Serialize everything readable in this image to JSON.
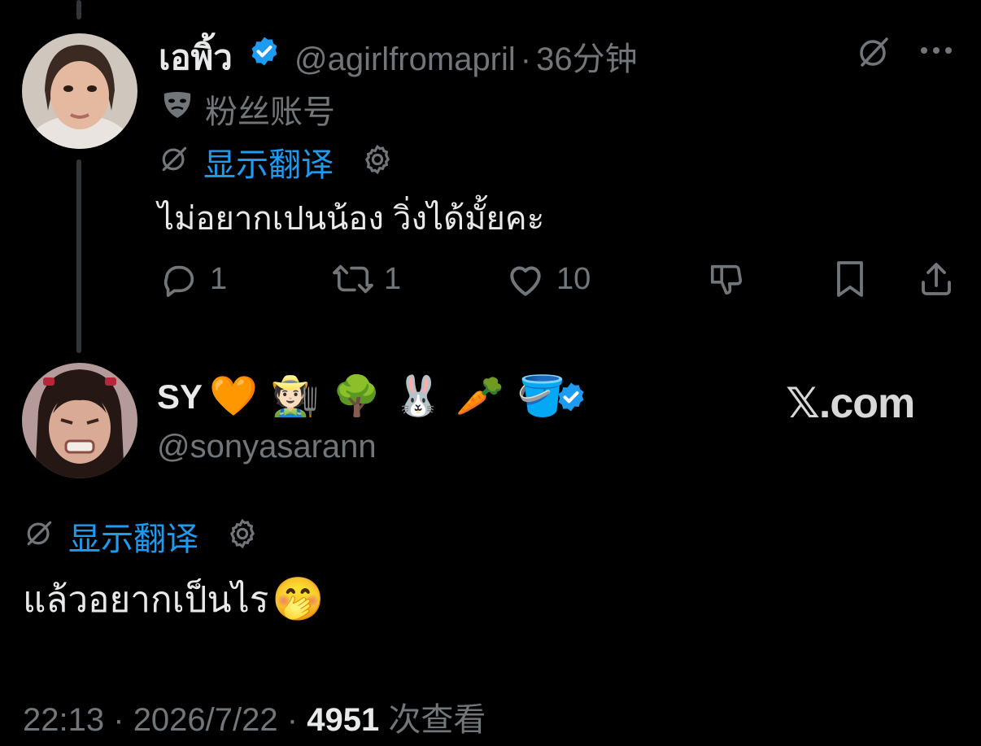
{
  "parent_tweet": {
    "display_name": "เอพิ้ว",
    "handle": "@agirlfromapril",
    "separator": "·",
    "time_ago": "36分钟",
    "label_text": "粉丝账号",
    "translate_text": "显示翻译",
    "text": "ไม่อยากเปนน้อง วิ่งได้มั้ยคะ",
    "actions": {
      "reply_count": "1",
      "retweet_count": "1",
      "like_count": "10"
    },
    "icons": [
      "verified-badge-icon",
      "grok-icon",
      "more-icon",
      "mask-icon",
      "translate-icon",
      "settings-icon",
      "reply-icon",
      "retweet-icon",
      "like-icon",
      "dislike-icon",
      "bookmark-icon",
      "share-icon"
    ]
  },
  "main_tweet": {
    "display_name": "SY",
    "name_emojis": [
      "🧡",
      "🧑🏻‍🌾",
      "🌳",
      "🐰",
      "🥕",
      "🪣"
    ],
    "handle": "@sonyasarann",
    "translate_text": "显示翻译",
    "text": "แล้วอยากเป็นไร",
    "text_emoji": "🤭",
    "footer": {
      "time": "22:13",
      "sep1": "·",
      "date": "2026/7/22",
      "sep2": "·",
      "views_count": "4951",
      "views_label": "次查看"
    }
  },
  "watermark": "𝕏.com",
  "colors": {
    "background": "#000000",
    "text_primary": "#e7e9ea",
    "text_secondary": "#71767b",
    "accent": "#1d9bf0"
  }
}
